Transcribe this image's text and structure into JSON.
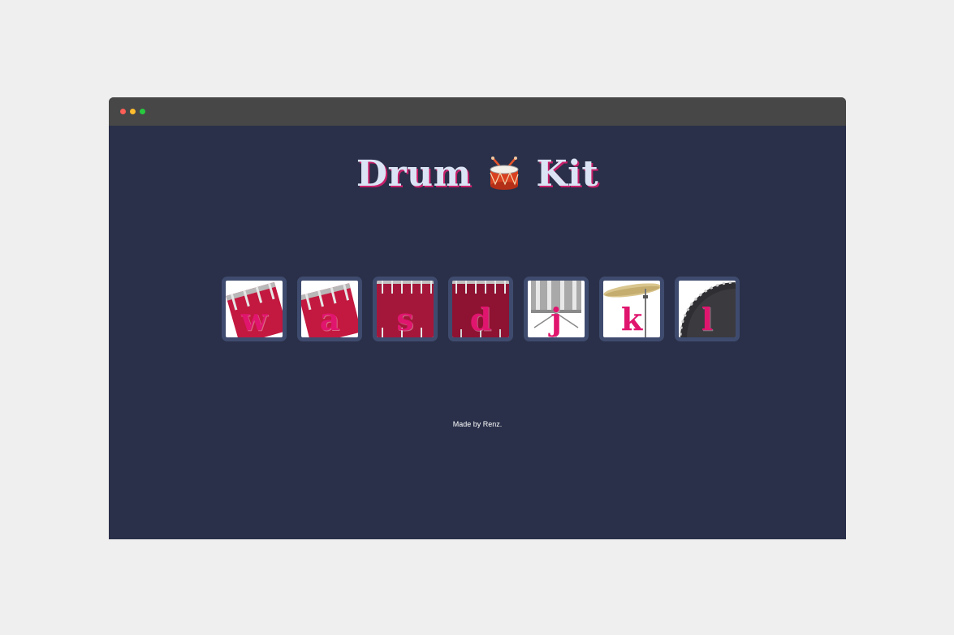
{
  "window": {
    "controls": [
      {
        "name": "close",
        "color": "#ff5f56"
      },
      {
        "name": "minimize",
        "color": "#ffbd2e"
      },
      {
        "name": "maximize",
        "color": "#27c93f"
      }
    ]
  },
  "header": {
    "title_part1": "Drum",
    "title_icon": "drum-emoji",
    "title_part2": "Kit"
  },
  "drums": [
    {
      "key": "w",
      "icon": "tom-tom-1"
    },
    {
      "key": "a",
      "icon": "tom-tom-2"
    },
    {
      "key": "s",
      "icon": "tom-tom-3"
    },
    {
      "key": "d",
      "icon": "tom-tom-4"
    },
    {
      "key": "j",
      "icon": "snare"
    },
    {
      "key": "k",
      "icon": "crash-cymbal"
    },
    {
      "key": "l",
      "icon": "kick-drum"
    }
  ],
  "footer": {
    "text": "Made by Renz."
  },
  "colors": {
    "page_bg": "#efefef",
    "app_bg": "#2a3049",
    "button_border": "#3f4b6e",
    "key_text": "#e0156e",
    "title_text": "#dbe4f5",
    "title_shadow": "#c8206a"
  }
}
